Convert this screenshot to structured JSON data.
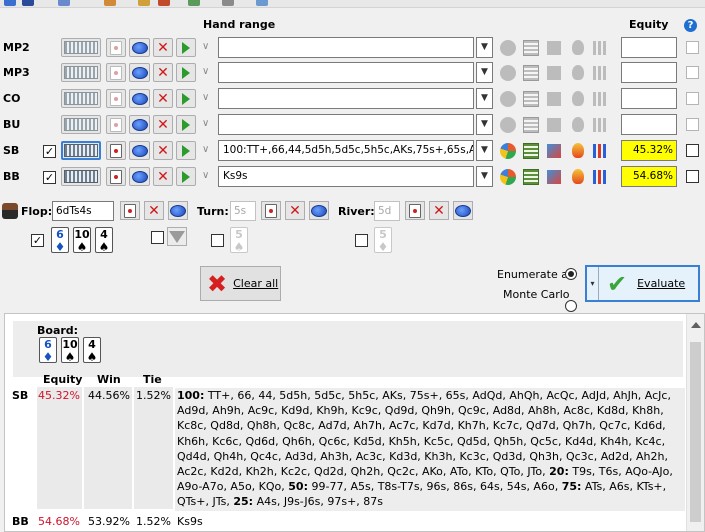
{
  "headers": {
    "hand_range": "Hand range",
    "equity": "Equity",
    "help": "?"
  },
  "players": [
    {
      "pos": "MP2",
      "range": "",
      "equity": "",
      "active": false
    },
    {
      "pos": "MP3",
      "range": "",
      "equity": "",
      "active": false
    },
    {
      "pos": "CO",
      "range": "",
      "equity": "",
      "active": false
    },
    {
      "pos": "BU",
      "range": "",
      "equity": "",
      "active": false
    },
    {
      "pos": "SB",
      "range": "100:TT+,66,44,5d5h,5d5c,5h5c,AKs,75s+,65s,AdQ",
      "equity": "45.32%",
      "active": true
    },
    {
      "pos": "BB",
      "range": "Ks9s",
      "equity": "54.68%",
      "active": true
    }
  ],
  "board": {
    "flop_label": "Flop:",
    "flop_value": "6dTs4s",
    "turn_label": "Turn:",
    "turn_placeholder": "5s",
    "river_label": "River:",
    "river_placeholder": "5d",
    "flop_cards": [
      {
        "rank": "6",
        "suit": "♦",
        "color": "blue"
      },
      {
        "rank": "10",
        "suit": "♠",
        "color": "black"
      },
      {
        "rank": "4",
        "suit": "♠",
        "color": "black"
      }
    ],
    "turn_card": {
      "rank": "5",
      "suit": "♠"
    },
    "river_card": {
      "rank": "5",
      "suit": "♦"
    }
  },
  "actions": {
    "clear_all": "Clear all",
    "enumerate_all": "Enumerate all",
    "monte_carlo": "Monte Carlo",
    "evaluate": "Evaluate"
  },
  "results": {
    "board_label": "Board:",
    "board_cards": [
      {
        "rank": "6",
        "suit": "♦",
        "color": "blue"
      },
      {
        "rank": "10",
        "suit": "♠",
        "color": "black"
      },
      {
        "rank": "4",
        "suit": "♠",
        "color": "black"
      }
    ],
    "columns": [
      "Equity",
      "Win",
      "Tie"
    ],
    "rows": [
      {
        "pos": "SB",
        "equity": "45.32%",
        "win": "44.56%",
        "tie": "1.52%",
        "hands_parts": [
          {
            "b": "100:"
          },
          {
            "t": " TT+, 66, 44, 5d5h, 5d5c, 5h5c, AKs, 75s+, 65s, AdQd, AhQh, AcQc, AdJd, AhJh, AcJc, Ad9d, Ah9h, Ac9c, Kd9d, Kh9h, Kc9c, Qd9d, Qh9h, Qc9c, Ad8d, Ah8h, Ac8c, Kd8d, Kh8h, Kc8c, Qd8d, Qh8h, Qc8c, Ad7d, Ah7h, Ac7c, Kd7d, Kh7h, Kc7c, Qd7d, Qh7h, Qc7c, Kd6d, Kh6h, Kc6c, Qd6d, Qh6h, Qc6c, Kd5d, Kh5h, Kc5c, Qd5d, Qh5h, Qc5c, Kd4d, Kh4h, Kc4c, Qd4d, Qh4h, Qc4c, Ad3d, Ah3h, Ac3c, Kd3d, Kh3h, Kc3c, Qd3d, Qh3h, Qc3c, Ad2d, Ah2h, Ac2c, Kd2d, Kh2h, Kc2c, Qd2d, Qh2h, Qc2c, AKo, ATo, KTo, QTo, JTo, "
          },
          {
            "b": "20:"
          },
          {
            "t": " T9s, T6s, AQo-AJo, A9o-A7o, A5o, KQo, "
          },
          {
            "b": "50:"
          },
          {
            "t": " 99-77, A5s, T8s-T7s, 96s, 86s, 64s, 54s, A6o, "
          },
          {
            "b": "75:"
          },
          {
            "t": " ATs, A6s, KTs+, QTs+, JTs, "
          },
          {
            "b": "25:"
          },
          {
            "t": " A4s, J9s-J6s, 97s+, 87s"
          }
        ]
      },
      {
        "pos": "BB",
        "equity": "54.68%",
        "win": "53.92%",
        "tie": "1.52%",
        "hands": "Ks9s"
      }
    ]
  }
}
